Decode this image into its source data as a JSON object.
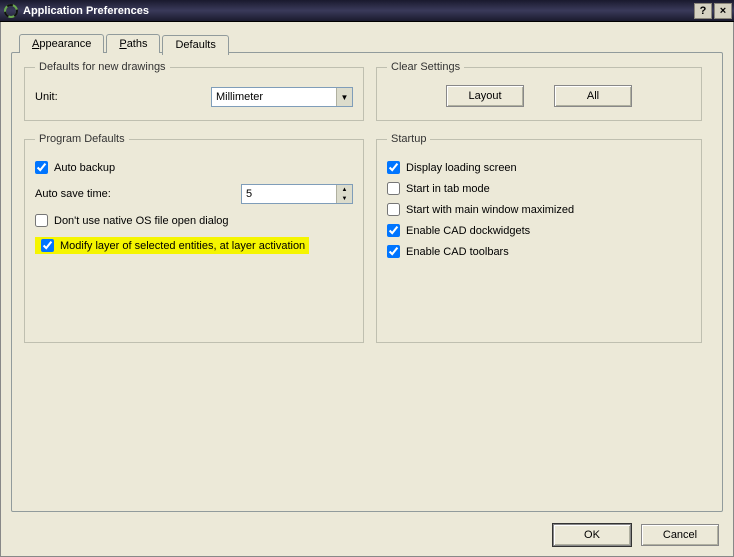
{
  "window": {
    "title": "Application Preferences",
    "help": "?",
    "close": "×"
  },
  "tabs": {
    "appearance": "Appearance",
    "paths": "Paths",
    "defaults": "Defaults"
  },
  "groups": {
    "defaults_legend": "Defaults for new drawings",
    "clear_legend": "Clear Settings",
    "program_legend": "Program Defaults",
    "startup_legend": "Startup"
  },
  "defaults": {
    "unit_label": "Unit:",
    "unit_value": "Millimeter"
  },
  "clear": {
    "layout": "Layout",
    "all": "All"
  },
  "program": {
    "autobackup": "Auto backup",
    "autosave_label": "Auto save time:",
    "autosave_value": "5",
    "no_native_dialog": "Don't use native OS file open dialog",
    "modify_layer": "Modify layer of selected entities, at  layer activation"
  },
  "startup": {
    "loading": "Display loading screen",
    "tabmode": "Start in tab mode",
    "maximized": "Start with main window maximized",
    "dockwidgets": "Enable CAD dockwidgets",
    "toolbars": "Enable CAD toolbars"
  },
  "buttons": {
    "ok": "OK",
    "cancel": "Cancel"
  }
}
